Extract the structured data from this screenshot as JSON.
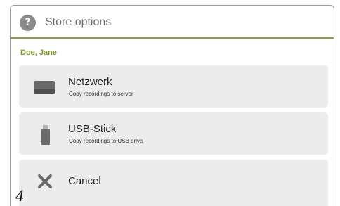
{
  "dialog": {
    "title": "Store options",
    "title_icon": "help-icon",
    "user": "Doe, Jane"
  },
  "options": [
    {
      "title": "Netzwerk",
      "subtitle": "Copy recordings to server",
      "icon": "network-drive-icon"
    },
    {
      "title": "USB-Stick",
      "subtitle": "Copy recordings to USB drive",
      "icon": "usb-stick-icon"
    },
    {
      "title": "Cancel",
      "icon": "close-icon"
    }
  ],
  "page_number": "4",
  "colors": {
    "accent": "#8aa33c",
    "user_text": "#7f9b2b",
    "option_bg": "#ececec",
    "icon_gray": "#6a6a6a"
  }
}
